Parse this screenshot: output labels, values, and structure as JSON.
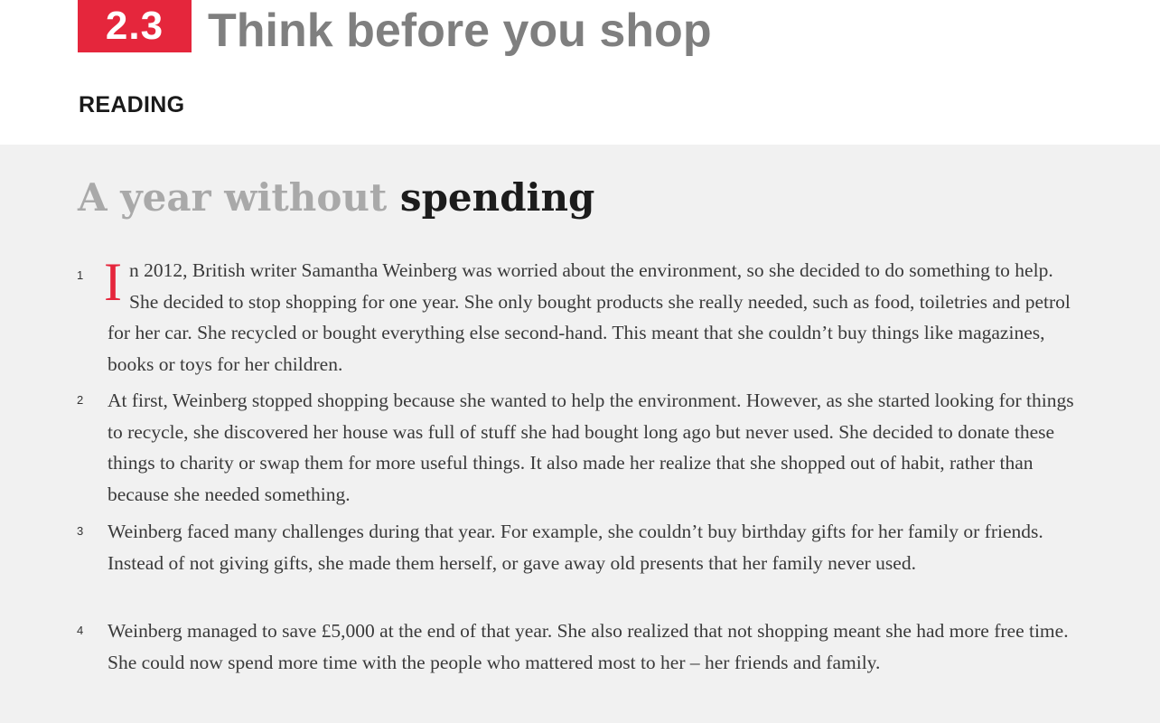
{
  "unit": {
    "number": "2.3",
    "title": "Think before you shop"
  },
  "section_label": "READING",
  "article": {
    "title_light": "A year without ",
    "title_dark": "spending",
    "dropcap": "I",
    "paragraphs": [
      {
        "number": "1",
        "text": "n 2012, British writer Samantha Weinberg was worried about the environment, so she decided to do something to help. She decided to stop shopping for one year. She only bought products she really needed, such as food, toiletries and petrol for her car. She recycled or bought everything else second-hand. This meant that she couldn’t buy things like magazines, books or toys for her children."
      },
      {
        "number": "2",
        "text": "At first, Weinberg stopped shopping because she wanted to help the environment. However, as she started looking for things to recycle, she discovered her house was full of stuff she had bought long ago but never used. She decided to donate these things to charity or swap them for more useful things. It also made her realize that she shopped out of habit, rather than because she needed something."
      },
      {
        "number": "3",
        "text": "Weinberg faced many challenges during that year. For example, she couldn’t buy birthday gifts for her family or friends. Instead of not giving gifts, she made them herself, or gave away old presents that her family never used."
      },
      {
        "number": "4",
        "text": "Weinberg managed to save £5,000 at the end of that year. She also realized that not shopping meant she had more free time. She could now spend more time with the people who mattered most to her – her friends and family."
      }
    ]
  },
  "colors": {
    "accent": "#e5263c",
    "title_grey": "#7f7f7f",
    "panel_bg": "#f1f1f1"
  }
}
